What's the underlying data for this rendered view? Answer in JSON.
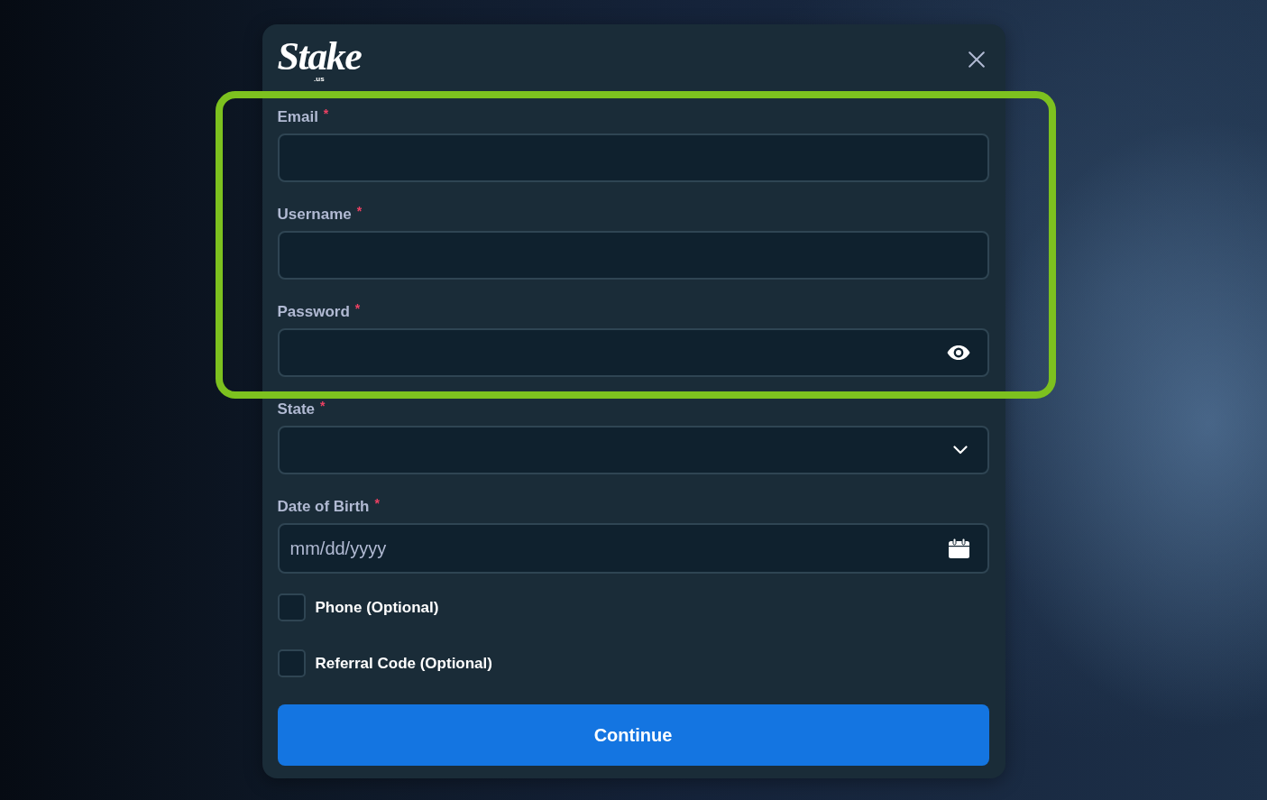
{
  "dialog": {
    "logo": {
      "wordmark": "Stake",
      "suffix": ".us"
    },
    "fields": [
      {
        "kind": "email",
        "label": "Email",
        "required_mark": "*",
        "highlighted": true
      },
      {
        "kind": "text",
        "label": "Username",
        "required_mark": "*",
        "highlighted": true
      },
      {
        "kind": "password",
        "label": "Password",
        "required_mark": "*",
        "highlighted": true
      },
      {
        "kind": "select",
        "label": "State",
        "required_mark": "*",
        "highlighted": false
      },
      {
        "kind": "date",
        "label": "Date of Birth",
        "required_mark": "*",
        "placeholder": "mm/dd/yyyy",
        "highlighted": false
      }
    ],
    "options": [
      {
        "label": "Phone (Optional)",
        "checked": false
      },
      {
        "label": "Referral Code (Optional)",
        "checked": false
      }
    ],
    "submit": {
      "label": "Continue"
    }
  }
}
